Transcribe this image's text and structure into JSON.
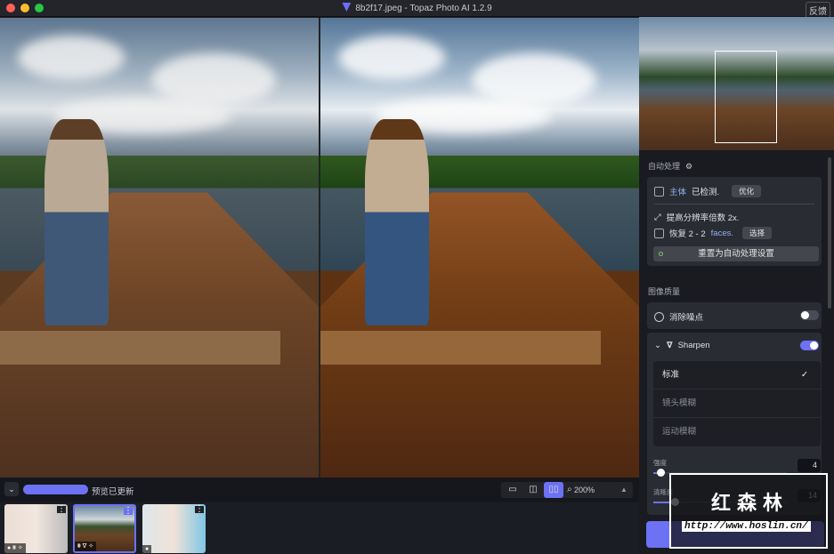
{
  "window": {
    "title": "8b2f17.jpeg - Topaz Photo AI 1.2.9",
    "feedback": "反馈",
    "traffic_colors": [
      "#ff5f57",
      "#febc2e",
      "#28c840"
    ]
  },
  "autopilot": {
    "title": "自动处理",
    "subject_label": "主体",
    "detected": "已检测.",
    "optimize": "优化",
    "upscale": "提高分辨率倍数 2x.",
    "recover_prefix": "恢复 2 - 2",
    "faces": "faces.",
    "select": "选择",
    "reset": "重置为自动处理设置"
  },
  "quality": {
    "title": "图像质量",
    "denoise": {
      "label": "消除噪点",
      "enabled": false
    },
    "sharpen": {
      "label": "Sharpen",
      "enabled": true,
      "options": [
        "标准",
        "镜头模糊",
        "运动模糊"
      ],
      "selected": "标准",
      "strength_label": "强度",
      "strength": 4,
      "clarity_label": "清晰度",
      "clarity": 14
    }
  },
  "bottom": {
    "status": "预览已更新",
    "zoom": "200%"
  },
  "thumbnails": [
    {
      "name": "portrait-1"
    },
    {
      "name": "boat",
      "selected": true
    },
    {
      "name": "portrait-2"
    }
  ],
  "watermark": {
    "text": "红森林",
    "url": "http://www.hoslin.cn/"
  },
  "accent": "#6c72f3"
}
